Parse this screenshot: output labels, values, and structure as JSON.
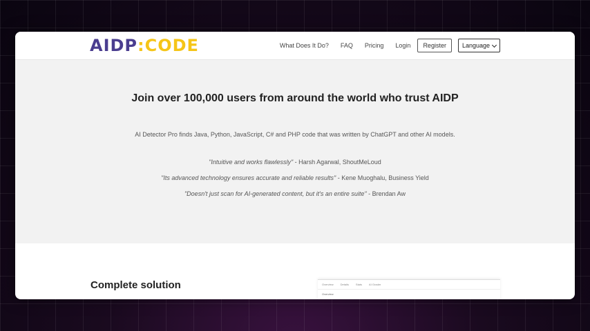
{
  "logo": {
    "part1": "AIDP",
    "part2": ":CODE"
  },
  "nav": {
    "links": [
      "What Does It Do?",
      "FAQ",
      "Pricing",
      "Login"
    ],
    "register": "Register",
    "language": "Language"
  },
  "hero": {
    "title": "Join over 100,000 users from around the world who trust AIDP",
    "subtitle": "AI Detector Pro finds Java, Python, JavaScript, C# and PHP code that was written by ChatGPT and other AI models.",
    "quotes": [
      {
        "text": "\"Intuitive and works flawlessly\"",
        "author": " - Harsh Agarwal, ShoutMeLoud"
      },
      {
        "text": "\"Its advanced technology ensures accurate and reliable results\"",
        "author": " - Kene Muoghalu, Business Yield"
      },
      {
        "text": "\"Doesn't just scan for AI-generated content, but it's an entire suite\"",
        "author": " - Brendan Aw"
      }
    ]
  },
  "section": {
    "title": "Complete solution"
  },
  "preview": {
    "tabs": [
      "Overview",
      "Details",
      "Stats",
      "AI Grader"
    ],
    "heading": "Overview"
  },
  "colors": {
    "logo_primary": "#4a3d8f",
    "logo_accent": "#f5c518",
    "hero_bg": "#f2f2f2"
  }
}
